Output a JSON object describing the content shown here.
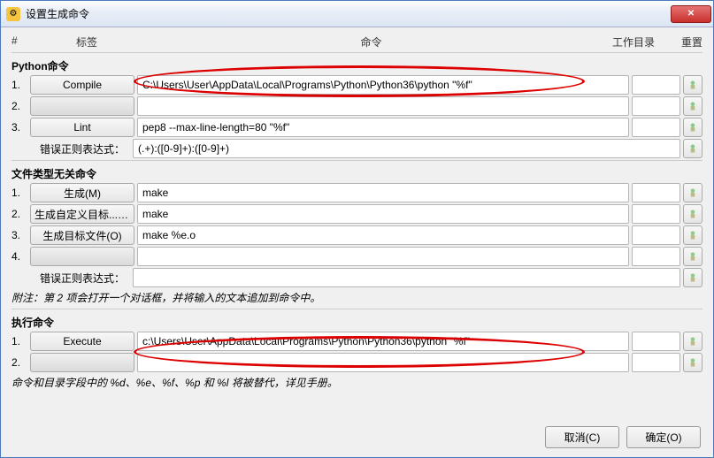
{
  "window": {
    "title": "设置生成命令"
  },
  "headers": {
    "num": "#",
    "label": "标签",
    "cmd": "命令",
    "wd": "工作目录",
    "reset": "重置"
  },
  "sections": {
    "python": {
      "title": "Python命令",
      "rows": [
        {
          "n": "1.",
          "label": "Compile",
          "cmd": "C:\\Users\\User\\AppData\\Local\\Programs\\Python\\Python36\\python \"%f\"",
          "wd": ""
        },
        {
          "n": "2.",
          "label": "",
          "cmd": "",
          "wd": ""
        },
        {
          "n": "3.",
          "label": "Lint",
          "cmd": "pep8 --max-line-length=80 \"%f\"",
          "wd": ""
        }
      ],
      "regex_label": "错误正则表达式：",
      "regex": "(.+):([0-9]+):([0-9]+)"
    },
    "filetype": {
      "title": "文件类型无关命令",
      "rows": [
        {
          "n": "1.",
          "label": "生成(M)",
          "cmd": "make",
          "wd": ""
        },
        {
          "n": "2.",
          "label": "生成自定义目标...(T)",
          "cmd": "make",
          "wd": ""
        },
        {
          "n": "3.",
          "label": "生成目标文件(O)",
          "cmd": "make %e.o",
          "wd": ""
        },
        {
          "n": "4.",
          "label": "",
          "cmd": "",
          "wd": ""
        }
      ],
      "regex_label": "错误正则表达式：",
      "regex": "",
      "note": "附注：第 2 项会打开一个对话框，并将输入的文本追加到命令中。"
    },
    "execute": {
      "title": "执行命令",
      "rows": [
        {
          "n": "1.",
          "label": "Execute",
          "cmd": "c:\\Users\\User\\AppData\\Local\\Programs\\Python\\Python36\\python \"%f\"",
          "wd": ""
        },
        {
          "n": "2.",
          "label": "",
          "cmd": "",
          "wd": ""
        }
      ],
      "note": "命令和目录字段中的 %d、%e、%f、%p 和 %l 将被替代，详见手册。"
    }
  },
  "footer": {
    "cancel": "取消(C)",
    "ok": "确定(O)"
  }
}
